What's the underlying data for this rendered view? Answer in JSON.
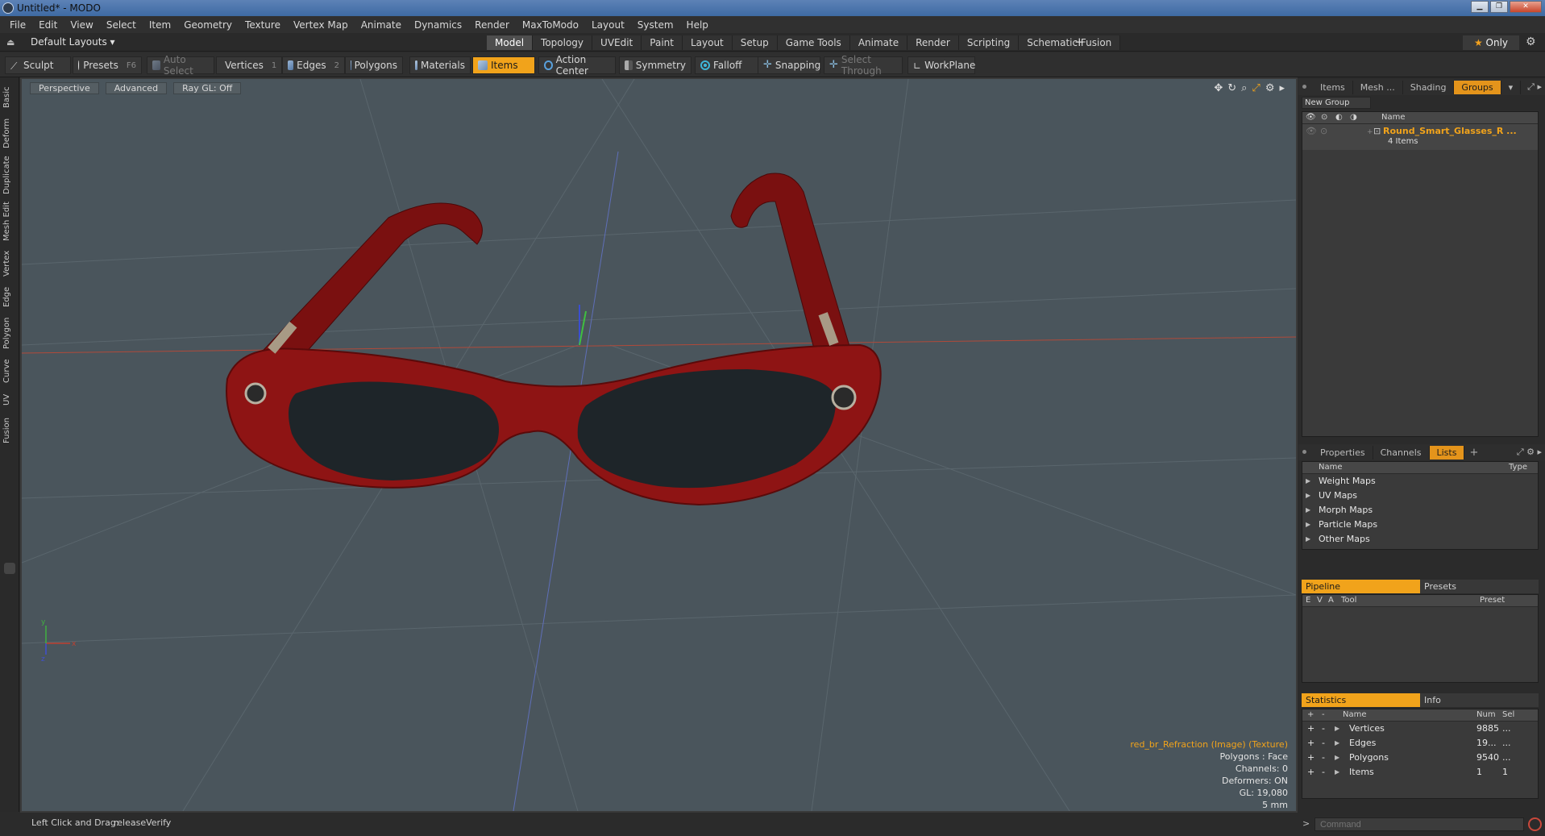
{
  "window": {
    "title": "Untitled* - MODO"
  },
  "menubar": [
    "File",
    "Edit",
    "View",
    "Select",
    "Item",
    "Geometry",
    "Texture",
    "Vertex Map",
    "Animate",
    "Dynamics",
    "Render",
    "MaxToModo",
    "Layout",
    "System",
    "Help"
  ],
  "layoutbar": {
    "layout_select": "Default Layouts ▾",
    "tabs": [
      "Model",
      "Topology",
      "UVEdit",
      "Paint",
      "Layout",
      "Setup",
      "Game Tools",
      "Animate",
      "Render",
      "Scripting",
      "Schematic Fusion"
    ],
    "active_tab": "Model",
    "add_tab": "+",
    "only_label": "Only"
  },
  "toolbar": {
    "sculpt": "Sculpt",
    "presets": "Presets",
    "presets_key": "F6",
    "auto_select": "Auto Select",
    "vertices": "Vertices",
    "vertices_key": "1",
    "edges": "Edges",
    "edges_key": "2",
    "polygons": "Polygons",
    "materials": "Materials",
    "items": "Items",
    "action_center": "Action Center",
    "symmetry": "Symmetry",
    "falloff": "Falloff",
    "snapping": "Snapping",
    "select_through": "Select Through",
    "workplane": "WorkPlane"
  },
  "left_tabs": [
    "Basic",
    "Deform",
    "Duplicate",
    "Mesh Edit",
    "Vertex",
    "Edge",
    "Polygon",
    "Curve",
    "UV",
    "Fusion"
  ],
  "viewport": {
    "perspective": "Perspective",
    "advanced": "Advanced",
    "raygl": "Ray GL: Off",
    "info": {
      "texture": "red_br_Refraction (Image) (Texture)",
      "polygons": "Polygons : Face",
      "channels": "Channels: 0",
      "deformers": "Deformers: ON",
      "gl": "GL: 19,080",
      "scale": "5 mm"
    },
    "axis_x": "x",
    "axis_y": "y",
    "axis_z": "z"
  },
  "statusbar": {
    "label": "Left Click and Drag:",
    "value": "releaseVerify"
  },
  "groups_panel": {
    "tabs": [
      "Items",
      "Mesh ...",
      "Shading",
      "Groups"
    ],
    "active_tab": "Groups",
    "new_group": "New Group",
    "col_name": "Name",
    "group_name": "Round_Smart_Glasses_R ...",
    "group_count": "4 Items"
  },
  "lists_panel": {
    "tabs": [
      "Properties",
      "Channels",
      "Lists"
    ],
    "active_tab": "Lists",
    "col_name": "Name",
    "col_type": "Type",
    "items": [
      "Weight Maps",
      "UV Maps",
      "Morph Maps",
      "Particle Maps",
      "Other Maps"
    ]
  },
  "pipeline_panel": {
    "tabs": [
      "Pipeline",
      "Presets"
    ],
    "cols": {
      "e": "E",
      "v": "V",
      "a": "A",
      "tool": "Tool",
      "preset": "Preset"
    }
  },
  "stats_panel": {
    "tabs": [
      "Statistics",
      "Info"
    ],
    "cols": {
      "plus": "+",
      "minus": "-",
      "name": "Name",
      "num": "Num",
      "sel": "Sel"
    },
    "rows": [
      {
        "name": "Vertices",
        "num": "9885",
        "sel": "..."
      },
      {
        "name": "Edges",
        "num": "19...",
        "sel": "..."
      },
      {
        "name": "Polygons",
        "num": "9540",
        "sel": "..."
      },
      {
        "name": "Items",
        "num": "1",
        "sel": "1"
      }
    ]
  },
  "command": {
    "placeholder": "Command"
  },
  "colors": {
    "accent": "#f1a31b",
    "frame_red": "#8e1414",
    "viewport_bg": "#4a555c"
  }
}
